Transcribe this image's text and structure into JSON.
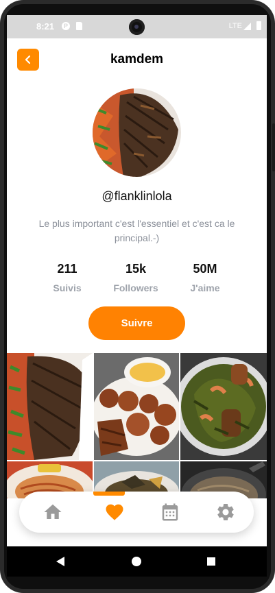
{
  "status_bar": {
    "time": "8:21",
    "network": "LTE"
  },
  "header": {
    "title": "kamdem"
  },
  "profile": {
    "handle": "@flanklinlola",
    "bio": "Le plus important c'est l'essentiel et c'est ca le principal.-)"
  },
  "stats": [
    {
      "value": "211",
      "label": "Suivis"
    },
    {
      "value": "15k",
      "label": "Followers"
    },
    {
      "value": "50M",
      "label": "J'aime"
    }
  ],
  "follow_button": {
    "label": "Suivre"
  },
  "bottom_nav": {
    "items": [
      {
        "icon": "home-icon",
        "active": false
      },
      {
        "icon": "heart-icon",
        "active": true
      },
      {
        "icon": "calendar-icon",
        "active": false
      },
      {
        "icon": "gear-icon",
        "active": false
      }
    ]
  },
  "colors": {
    "accent": "#ff8a00",
    "muted": "#9ea3ab",
    "inactive_icon": "#9a9a9a"
  }
}
